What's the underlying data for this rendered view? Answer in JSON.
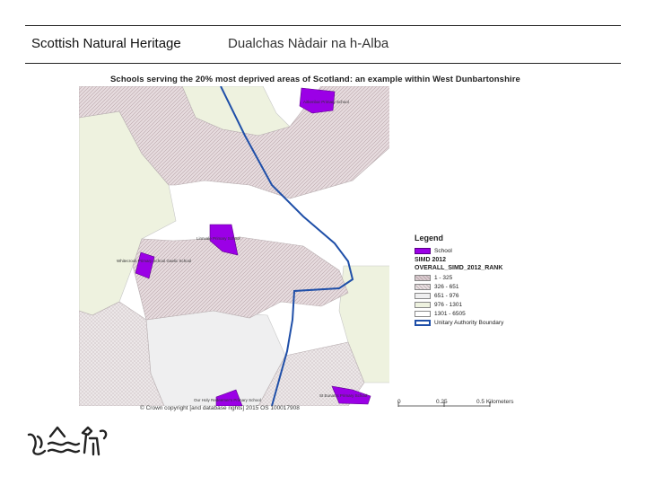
{
  "header": {
    "org_en": "Scottish Natural Heritage",
    "org_gd": "Dualchas Nàdair na h-Alba"
  },
  "map": {
    "title": "Schools serving the 20% most deprived areas of Scotland: an example within West Dunbartonshire",
    "schools": [
      {
        "id": "s1",
        "label": "Aitkenbar Primary School"
      },
      {
        "id": "s2",
        "label": "Linnvale Primary School"
      },
      {
        "id": "s3",
        "label": "Whitecrook Primary School Gaelic School"
      },
      {
        "id": "s4",
        "label": "Our Holy Redeemer's Primary School"
      },
      {
        "id": "s5",
        "label": "St Eunan's Primary School"
      }
    ],
    "copyright": "© Crown copyright [and database rights] 2015 OS 100017908"
  },
  "legend": {
    "title": "Legend",
    "school_label": "School",
    "simd_heading": "SIMD 2012",
    "rank_heading": "OVERALL_SIMD_2012_RANK",
    "classes": [
      {
        "label": "1 - 325",
        "color": "#d9cbcf"
      },
      {
        "label": "326 - 651",
        "color": "#e6dfe0"
      },
      {
        "label": "651 - 976",
        "color": "#efeff0"
      },
      {
        "label": "976 - 1301",
        "color": "#eef2df"
      },
      {
        "label": "1301 - 6505",
        "color": "#ffffff"
      }
    ],
    "boundary_label": "Unitary Authority Boundary"
  },
  "scale": {
    "ticks": [
      "0",
      "0.25",
      "0.5 Kilometers"
    ]
  },
  "colors": {
    "school": "#9b00e6",
    "boundary": "#1f4fa8",
    "deprived": "#d9cbcf",
    "light": "#eef2df"
  },
  "logo": {
    "icon": "snh-logo-icon"
  }
}
